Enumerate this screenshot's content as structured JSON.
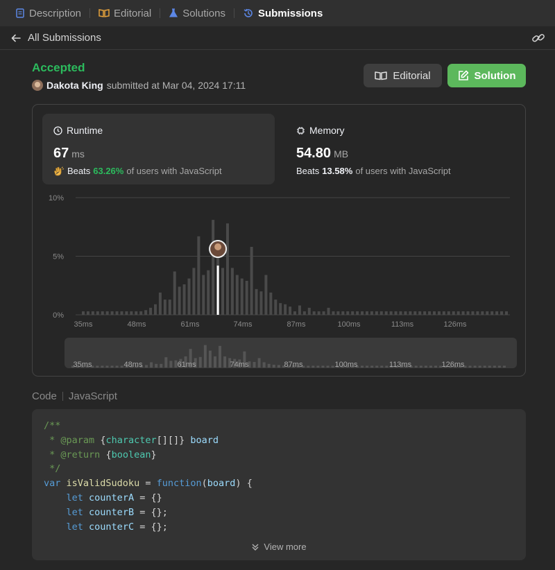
{
  "tabs": [
    {
      "label": "Description",
      "icon": "description-icon",
      "color": "#5c87e6",
      "active": false
    },
    {
      "label": "Editorial",
      "icon": "book-icon",
      "color": "#e6a23c",
      "active": false
    },
    {
      "label": "Solutions",
      "icon": "flask-icon",
      "color": "#5c87e6",
      "active": false
    },
    {
      "label": "Submissions",
      "icon": "history-icon",
      "color": "#5c87e6",
      "active": true
    }
  ],
  "header": {
    "back_label": "All Submissions"
  },
  "submission": {
    "status": "Accepted",
    "user": "Dakota King",
    "submitted_text": "submitted at Mar 04, 2024 17:11"
  },
  "buttons": {
    "editorial": "Editorial",
    "solution": "Solution"
  },
  "runtime": {
    "label": "Runtime",
    "value": "67",
    "unit": "ms",
    "beats_label": "Beats",
    "beats_pct": "63.26%",
    "beats_suffix": "of users with JavaScript"
  },
  "memory": {
    "label": "Memory",
    "value": "54.80",
    "unit": "MB",
    "beats_label": "Beats",
    "beats_pct": "13.58%",
    "beats_suffix": "of users with JavaScript"
  },
  "chart_data": {
    "type": "bar",
    "y_ticks": [
      "10%",
      "5%",
      "0%"
    ],
    "ylim": [
      0,
      10
    ],
    "x_ticks": [
      "35ms",
      "48ms",
      "61ms",
      "74ms",
      "87ms",
      "100ms",
      "113ms",
      "126ms"
    ],
    "values": [
      0.3,
      0.3,
      0.3,
      0.3,
      0.3,
      0.3,
      0.3,
      0.3,
      0.3,
      0.3,
      0.3,
      0.3,
      0.3,
      0.4,
      0.6,
      0.9,
      1.9,
      1.3,
      1.3,
      3.7,
      2.4,
      2.6,
      3.1,
      4.0,
      6.7,
      3.4,
      3.8,
      8.1,
      6.1,
      4.0,
      7.8,
      4.0,
      3.4,
      3.1,
      2.9,
      5.8,
      2.2,
      2.0,
      3.4,
      1.9,
      1.3,
      1.0,
      0.9,
      0.7,
      0.3,
      0.8,
      0.3,
      0.6,
      0.3,
      0.3,
      0.3,
      0.6,
      0.3,
      0.3,
      0.3,
      0.3,
      0.3,
      0.3,
      0.3,
      0.3,
      0.3,
      0.3,
      0.3,
      0.3,
      0.3,
      0.3,
      0.3,
      0.3,
      0.3,
      0.3,
      0.3,
      0.3,
      0.3,
      0.3,
      0.3,
      0.3,
      0.3,
      0.3,
      0.3,
      0.3,
      0.3,
      0.3,
      0.3,
      0.3,
      0.3,
      0.3,
      0.3,
      0.3,
      0.3
    ],
    "highlight_index": 28,
    "highlight_value": 4.2
  },
  "code": {
    "header": "Code",
    "language": "JavaScript",
    "view_more": "View more"
  }
}
